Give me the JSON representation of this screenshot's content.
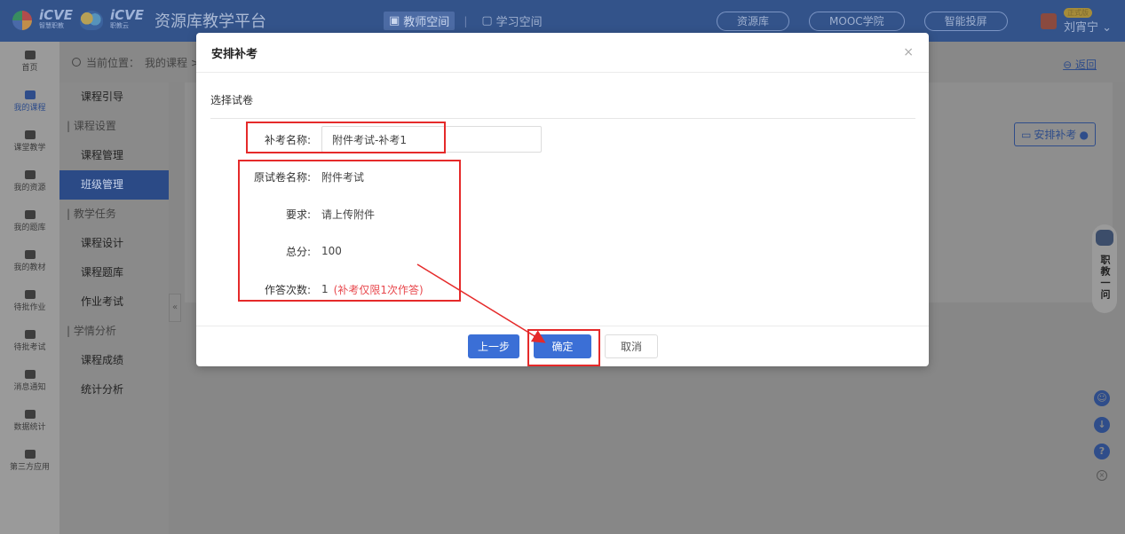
{
  "header": {
    "logo1": {
      "text": "iCVE",
      "sub": "智慧职教"
    },
    "logo2": {
      "text": "iCVE",
      "sub": "职教云"
    },
    "platform_title": "资源库教学平台",
    "spaces": [
      {
        "label": "教师空间",
        "active": true
      },
      {
        "label": "学习空间",
        "active": false
      }
    ],
    "pills": [
      "资源库",
      "MOOC学院",
      "智能投屏"
    ],
    "user": {
      "badge": "正式版",
      "name": "刘宵宁 ⌄"
    }
  },
  "leftnav": [
    {
      "label": "首页",
      "icon": "home-icon"
    },
    {
      "label": "我的课程",
      "icon": "book-icon",
      "active": true
    },
    {
      "label": "课堂教学",
      "icon": "play-icon"
    },
    {
      "label": "我的资源",
      "icon": "library-icon"
    },
    {
      "label": "我的题库",
      "icon": "question-bank-icon"
    },
    {
      "label": "我的教材",
      "icon": "textbook-icon"
    },
    {
      "label": "待批作业",
      "icon": "homework-icon"
    },
    {
      "label": "待批考试",
      "icon": "exam-icon"
    },
    {
      "label": "消息通知",
      "icon": "message-icon"
    },
    {
      "label": "数据统计",
      "icon": "chart-icon"
    },
    {
      "label": "第三方应用",
      "icon": "apps-icon"
    }
  ],
  "breadcrumb": {
    "prefix": "当前位置：",
    "path": "我的课程 > 主",
    "back": "返回"
  },
  "subnav": [
    {
      "type": "item",
      "label": "课程引导"
    },
    {
      "type": "group",
      "label": "| 课程设置"
    },
    {
      "type": "item",
      "label": "课程管理"
    },
    {
      "type": "item",
      "label": "班级管理",
      "active": true
    },
    {
      "type": "group",
      "label": "| 教学任务"
    },
    {
      "type": "item",
      "label": "课程设计"
    },
    {
      "type": "item",
      "label": "课程题库"
    },
    {
      "type": "item",
      "label": "作业考试"
    },
    {
      "type": "group",
      "label": "| 学情分析"
    },
    {
      "type": "item",
      "label": "课程成绩"
    },
    {
      "type": "item",
      "label": "统计分析"
    }
  ],
  "main": {
    "arrange_button": "安排补考"
  },
  "assistant": {
    "label": "职教一问"
  },
  "modal": {
    "title": "安排补考",
    "close": "×",
    "section": "选择试卷",
    "fields": {
      "makeup_name": {
        "label": "补考名称:",
        "value": "附件考试-补考1",
        "placeholder": ""
      },
      "original_name": {
        "label": "原试卷名称:",
        "value": "附件考试"
      },
      "requirement": {
        "label": "要求:",
        "value": "请上传附件"
      },
      "total_score": {
        "label": "总分:",
        "value": "100"
      },
      "attempts": {
        "label": "作答次数:",
        "value": "1",
        "note": "(补考仅限1次作答)"
      }
    },
    "buttons": {
      "prev": "上一步",
      "ok": "确定",
      "cancel": "取消"
    }
  },
  "colors": {
    "primary": "#3b6fd6",
    "annotation": "#e52a2a",
    "note_red": "#e8484d"
  }
}
